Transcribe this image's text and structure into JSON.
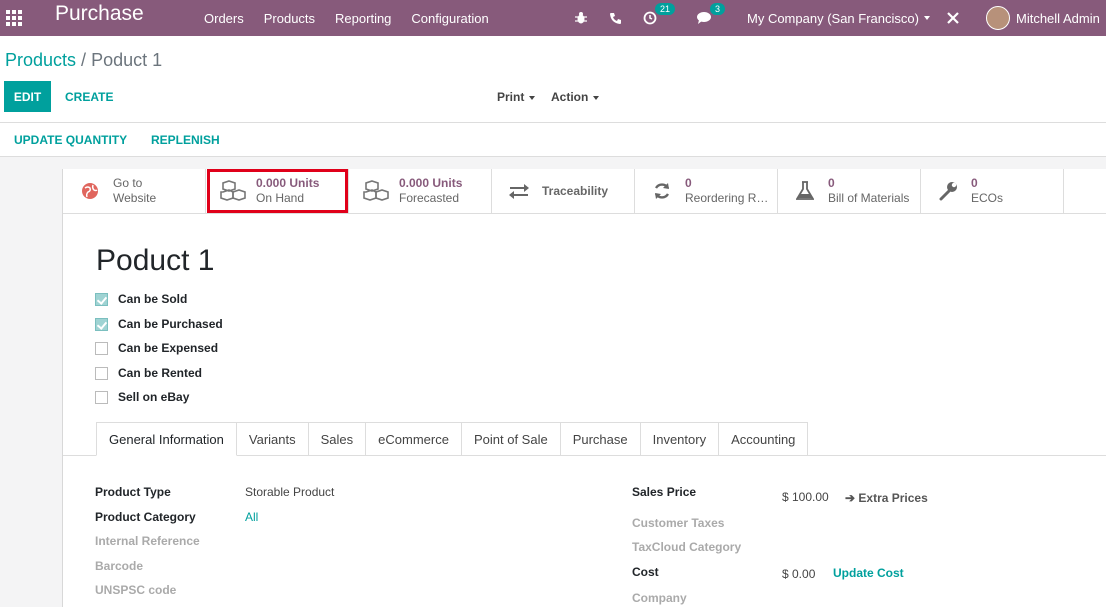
{
  "topbar": {
    "app_title": "Purchase",
    "menu": [
      "Orders",
      "Products",
      "Reporting",
      "Configuration"
    ],
    "activity_count": "21",
    "message_count": "3",
    "company": "My Company (San Francisco)",
    "user": "Mitchell Admin",
    "color": "#875a7b"
  },
  "control": {
    "breadcrumb_parent": "Products",
    "breadcrumb_sep": "/",
    "breadcrumb_current": "Poduct 1",
    "edit_label": "EDIT",
    "create_label": "CREATE",
    "print_label": "Print",
    "action_label": "Action",
    "update_quantity_label": "UPDATE QUANTITY",
    "replenish_label": "REPLENISH"
  },
  "smart_buttons": {
    "website": {
      "line1": "Go to",
      "line2": "Website",
      "icon": "globe-icon"
    },
    "on_hand": {
      "value": "0.000 Units",
      "label": "On Hand",
      "icon": "cubes-icon"
    },
    "forecasted": {
      "value": "0.000 Units",
      "label": "Forecasted",
      "icon": "cubes-icon"
    },
    "traceability": {
      "label": "Traceability",
      "icon": "exchange-icon"
    },
    "reordering": {
      "value": "0",
      "label": "Reordering Rules",
      "icon": "refresh-icon"
    },
    "bom": {
      "value": "0",
      "label": "Bill of Materials",
      "icon": "flask-icon"
    },
    "ecos": {
      "value": "0",
      "label": "ECOs",
      "icon": "wrench-icon"
    }
  },
  "product": {
    "name": "Poduct 1",
    "checks": [
      {
        "label": "Can be Sold",
        "checked": true
      },
      {
        "label": "Can be Purchased",
        "checked": true
      },
      {
        "label": "Can be Expensed",
        "checked": false
      },
      {
        "label": "Can be Rented",
        "checked": false
      },
      {
        "label": "Sell on eBay",
        "checked": false
      }
    ]
  },
  "tabs": [
    "General Information",
    "Variants",
    "Sales",
    "eCommerce",
    "Point of Sale",
    "Purchase",
    "Inventory",
    "Accounting"
  ],
  "general": {
    "product_type_label": "Product Type",
    "product_type_value": "Storable Product",
    "product_category_label": "Product Category",
    "product_category_value": "All",
    "internal_reference_label": "Internal Reference",
    "barcode_label": "Barcode",
    "unspsc_label": "UNSPSC code",
    "sales_price_label": "Sales Price",
    "sales_price_value": "$ 100.00",
    "extra_prices_label": "Extra Prices",
    "customer_taxes_label": "Customer Taxes",
    "taxcloud_label": "TaxCloud Category",
    "cost_label": "Cost",
    "cost_value": "$ 0.00",
    "update_cost_label": "Update Cost",
    "company_label": "Company"
  }
}
